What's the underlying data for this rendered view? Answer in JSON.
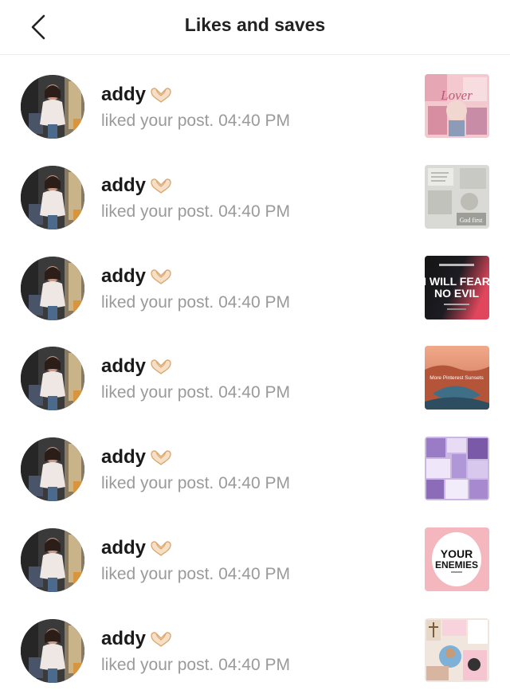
{
  "header": {
    "title": "Likes and saves",
    "back_icon": "chevron-left-icon"
  },
  "notifications": [
    {
      "name": "addy",
      "action": "liked your post.",
      "time": "04:40 PM",
      "thumb_theme": "pink-collage",
      "thumb_text": "Lover"
    },
    {
      "name": "addy",
      "action": "liked your post.",
      "time": "04:40 PM",
      "thumb_theme": "grey-collage",
      "thumb_text": "God first"
    },
    {
      "name": "addy",
      "action": "liked your post.",
      "time": "04:40 PM",
      "thumb_theme": "dark-gradient",
      "thumb_text": "I WILL FEAR NO EVIL"
    },
    {
      "name": "addy",
      "action": "liked your post.",
      "time": "04:40 PM",
      "thumb_theme": "canyon",
      "thumb_text": "More Pinterest Sunsets"
    },
    {
      "name": "addy",
      "action": "liked your post.",
      "time": "04:40 PM",
      "thumb_theme": "purple-collage",
      "thumb_text": ""
    },
    {
      "name": "addy",
      "action": "liked your post.",
      "time": "04:40 PM",
      "thumb_theme": "pink-circle",
      "thumb_text": "YOUR ENEMIES"
    },
    {
      "name": "addy",
      "action": "liked your post.",
      "time": "04:40 PM",
      "thumb_theme": "jesus-collage",
      "thumb_text": ""
    }
  ],
  "colors": {
    "name": "#1a1a1a",
    "subtext": "#9a9a9a",
    "divider": "#ececec"
  }
}
